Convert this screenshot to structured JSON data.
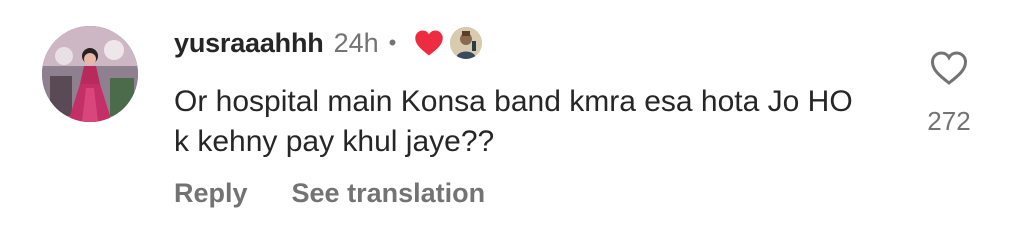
{
  "comment": {
    "username": "yusraaahhh",
    "time": "24h",
    "separator": "•",
    "text": "Or hospital main Konsa band kmra esa hota Jo HO k kehny pay khul jaye??",
    "reply_label": "Reply",
    "translate_label": "See translation",
    "like_count": "272"
  },
  "icons": {
    "creator_heart": "heart-filled-icon",
    "like": "heart-outline-icon"
  },
  "colors": {
    "text_primary": "#262626",
    "text_secondary": "#737373",
    "heart_red": "#ed2c42"
  }
}
